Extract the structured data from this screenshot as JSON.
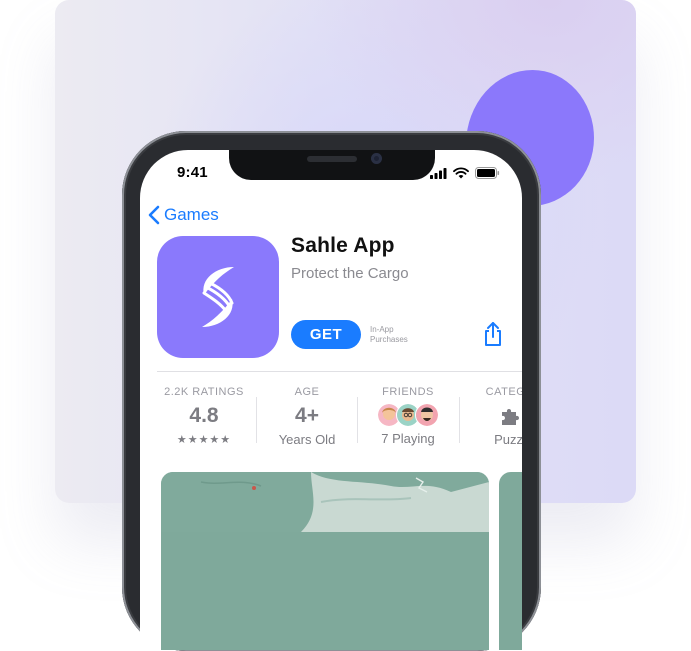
{
  "status_bar": {
    "time": "9:41"
  },
  "nav": {
    "back_label": "Games"
  },
  "app": {
    "name": "Sahle App",
    "subtitle": "Protect the Cargo",
    "get_label": "GET",
    "iap_line1": "In-App",
    "iap_line2": "Purchases",
    "icon_color": "#8a79fc"
  },
  "stats": {
    "ratings": {
      "label": "2.2K RATINGS",
      "value": "4.8",
      "stars": "★★★★★"
    },
    "age": {
      "label": "AGE",
      "value": "4+",
      "sub": "Years Old"
    },
    "friends": {
      "label": "FRIENDS",
      "sub": "7 Playing"
    },
    "category": {
      "label": "CATEGO",
      "sub": "Puzzl"
    }
  },
  "colors": {
    "accent": "#1a7cff",
    "brand": "#8b78fb"
  }
}
